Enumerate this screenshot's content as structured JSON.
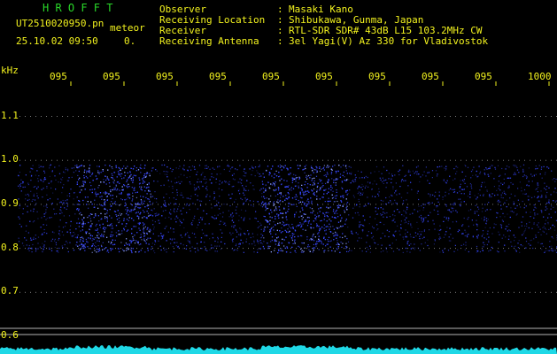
{
  "header": {
    "app_title": "H R O F F T",
    "filename": "UT2510020950.pn",
    "mode": "meteor",
    "datetime": "25.10.02 09:50",
    "count": "0.",
    "info_labels": [
      "Observer",
      "Receiving Location",
      "Receiver",
      "Receiving Antenna"
    ],
    "info_sep": ":",
    "info_values": [
      "Masaki Kano",
      "Shibukawa, Gunma, Japan",
      "RTL-SDR SDR# 43dB L15 103.2MHz CW",
      "3el Yagi(V) Az 330 for Vladivostok"
    ]
  },
  "axes": {
    "y_unit": "kHz",
    "y_ticks": [
      "1.1",
      "1.0",
      "0.9",
      "0.8",
      "0.7",
      "0.6"
    ],
    "x_ticks": [
      "095",
      "095",
      "095",
      "095",
      "095",
      "095",
      "095",
      "095",
      "095",
      "1000"
    ]
  },
  "colors": {
    "background": "#000000",
    "label_yellow": "#f2f21e",
    "title_green": "#29d829",
    "signal_blue": "#3848ff",
    "signal_bright": "#8fa0ff",
    "level_cyan": "#1fd8e6",
    "line_gray": "#b4b4b4"
  },
  "chart_data": {
    "type": "heatmap",
    "y_axis": {
      "unit": "kHz",
      "range": [
        0.59,
        1.15
      ]
    },
    "x_axis": {
      "tick_labels": [
        "0950",
        "0951",
        "0952",
        "0953",
        "0954",
        "0955",
        "0956",
        "0957",
        "0958",
        "0959",
        "1000"
      ]
    },
    "noise_band_khz": [
      0.79,
      0.99
    ],
    "intense_segments": [
      {
        "from_min": 1.1,
        "to_min": 2.5
      },
      {
        "from_min": 4.6,
        "to_min": 6.2
      }
    ]
  }
}
